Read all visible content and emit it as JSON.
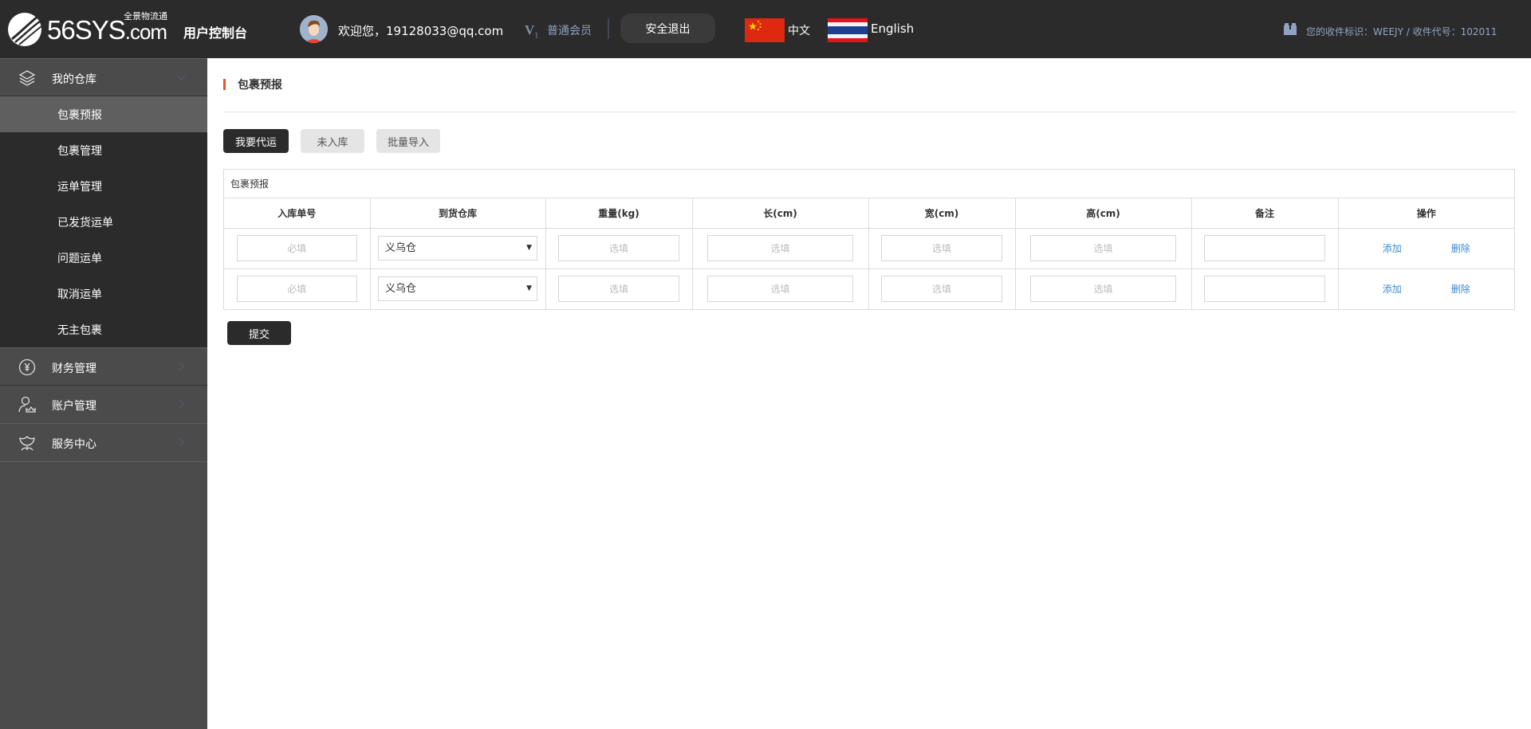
{
  "header": {
    "logo_text": "56SYS",
    "logo_domain": ".com",
    "logo_subtitle": "全景物流通",
    "console_title": "用户控制台",
    "welcome": "欢迎您，19128033@qq.com",
    "member_level_icon": "V",
    "member_level_num": "1",
    "member_label": "普通会员",
    "logout_label": "安全退出",
    "lang_cn_label": "中文",
    "lang_en_label": "English",
    "receive_info": "您的收件标识：WEEJY / 收件代号：102011"
  },
  "sidebar": {
    "groups": [
      {
        "label": "我的仓库",
        "icon": "layers-icon",
        "expanded": true,
        "items": [
          {
            "label": "包裹预报",
            "active": true
          },
          {
            "label": "包裹管理"
          },
          {
            "label": "运单管理"
          },
          {
            "label": "已发货运单"
          },
          {
            "label": "问题运单"
          },
          {
            "label": "取消运单"
          },
          {
            "label": "无主包裹"
          }
        ]
      },
      {
        "label": "财务管理",
        "icon": "yen-circle-icon"
      },
      {
        "label": "账户管理",
        "icon": "user-icon"
      },
      {
        "label": "服务中心",
        "icon": "lotus-icon"
      }
    ]
  },
  "main": {
    "page_title": "包裹预报",
    "tabs": [
      {
        "label": "我要代运",
        "active": true
      },
      {
        "label": "未入库"
      },
      {
        "label": "批量导入"
      }
    ],
    "panel_title": "包裹预报",
    "columns": [
      "入库单号",
      "到货仓库",
      "重量(kg)",
      "长(cm)",
      "宽(cm)",
      "高(cm)",
      "备注",
      "操作"
    ],
    "rows": [
      {
        "order_no": {
          "value": "",
          "placeholder": "必填"
        },
        "warehouse": "义乌仓",
        "weight": {
          "value": "",
          "placeholder": "选填"
        },
        "length": {
          "value": "",
          "placeholder": "选填"
        },
        "width": {
          "value": "",
          "placeholder": "选填"
        },
        "height": {
          "value": "",
          "placeholder": "选填"
        },
        "remark": {
          "value": "",
          "placeholder": ""
        },
        "add_label": "添加",
        "delete_label": "删除"
      },
      {
        "order_no": {
          "value": "",
          "placeholder": "必填"
        },
        "warehouse": "义乌仓",
        "weight": {
          "value": "",
          "placeholder": "选填"
        },
        "length": {
          "value": "",
          "placeholder": "选填"
        },
        "width": {
          "value": "",
          "placeholder": "选填"
        },
        "height": {
          "value": "",
          "placeholder": "选填"
        },
        "remark": {
          "value": "",
          "placeholder": ""
        },
        "add_label": "添加",
        "delete_label": "删除"
      }
    ],
    "submit_label": "提交"
  },
  "colors": {
    "header_bg": "#2b2b2b",
    "sidebar_bg": "#4b4b4b",
    "submenu_bg": "#2b2b2b",
    "submenu_active_bg": "#5f5f5f",
    "title_accent": "#e8562a",
    "link": "#3a8bd2"
  }
}
